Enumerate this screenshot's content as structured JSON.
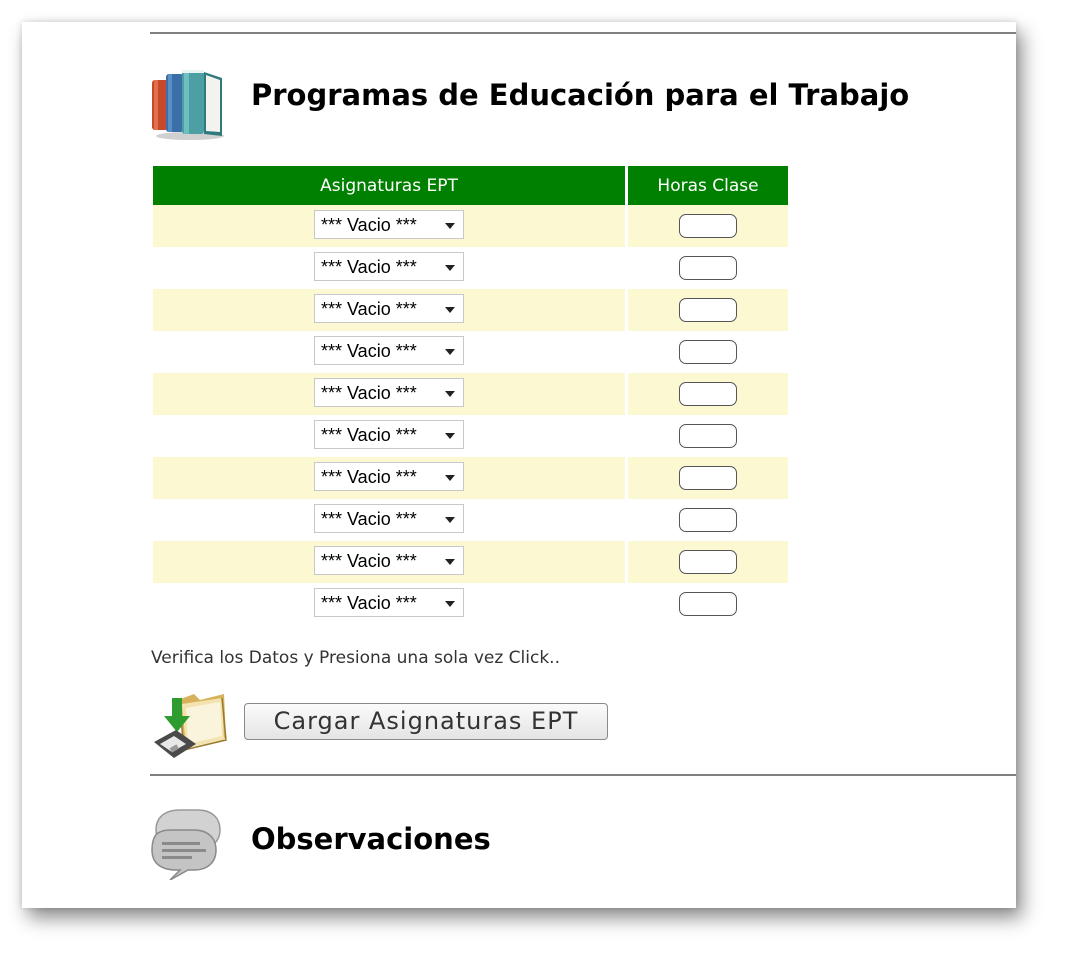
{
  "ept_section": {
    "title": "Programas de Educación para el Trabajo",
    "icon": "books-icon",
    "table": {
      "headers": [
        "Asignaturas EPT",
        "Horas Clase"
      ],
      "rows": [
        {
          "subject": "*** Vacio ***",
          "hours": ""
        },
        {
          "subject": "*** Vacio ***",
          "hours": ""
        },
        {
          "subject": "*** Vacio ***",
          "hours": ""
        },
        {
          "subject": "*** Vacio ***",
          "hours": ""
        },
        {
          "subject": "*** Vacio ***",
          "hours": ""
        },
        {
          "subject": "*** Vacio ***",
          "hours": ""
        },
        {
          "subject": "*** Vacio ***",
          "hours": ""
        },
        {
          "subject": "*** Vacio ***",
          "hours": ""
        },
        {
          "subject": "*** Vacio ***",
          "hours": ""
        },
        {
          "subject": "*** Vacio ***",
          "hours": ""
        }
      ]
    },
    "hint": "Verifica los Datos y Presiona una sola vez Click..",
    "submit_icon": "save-folder-icon",
    "submit_label": "Cargar Asignaturas EPT"
  },
  "observaciones_section": {
    "title": "Observaciones",
    "icon": "chat-bubbles-icon"
  },
  "colors": {
    "header_green": "#008000",
    "row_highlight": "#fbf8d2"
  }
}
